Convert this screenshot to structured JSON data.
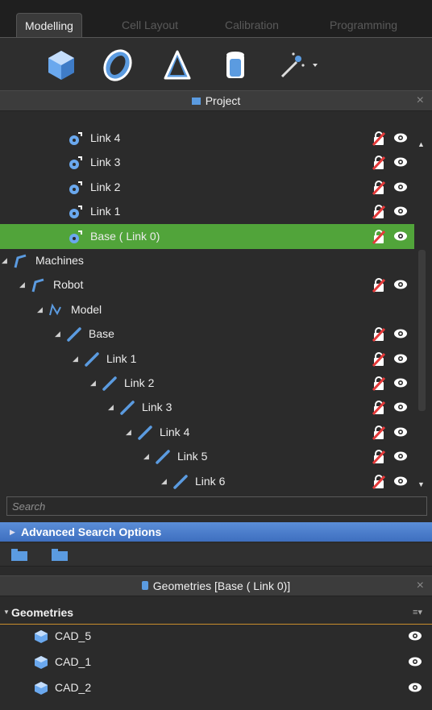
{
  "tabs": [
    {
      "label": "Modelling",
      "active": true
    },
    {
      "label": "Cell Layout",
      "active": false
    },
    {
      "label": "Calibration",
      "active": false
    },
    {
      "label": "Programming",
      "active": false
    }
  ],
  "toolbar": [
    {
      "icon": "box-icon"
    },
    {
      "icon": "ellipse-icon"
    },
    {
      "icon": "cone-icon"
    },
    {
      "icon": "cylinder-icon"
    },
    {
      "icon": "magic-wand-dropdown-icon"
    }
  ],
  "project": {
    "title": "Project",
    "close": "×",
    "menu": "≡▾"
  },
  "tree": [
    {
      "label": "Link 4",
      "indent": 4,
      "type": "link",
      "expand": false,
      "lock": true,
      "eye": true,
      "selected": false
    },
    {
      "label": "Link 3",
      "indent": 4,
      "type": "link",
      "expand": false,
      "lock": true,
      "eye": true,
      "selected": false
    },
    {
      "label": "Link 2",
      "indent": 4,
      "type": "link",
      "expand": false,
      "lock": true,
      "eye": true,
      "selected": false
    },
    {
      "label": "Link 1",
      "indent": 4,
      "type": "link",
      "expand": false,
      "lock": true,
      "eye": true,
      "selected": false
    },
    {
      "label": "Base ( Link 0)",
      "indent": 4,
      "type": "link",
      "expand": false,
      "lock": true,
      "eye": true,
      "selected": true
    },
    {
      "label": "Machines",
      "indent": 0,
      "type": "machine",
      "expand": true,
      "lock": false,
      "eye": false,
      "selected": false
    },
    {
      "label": "Robot",
      "indent": 1,
      "type": "machine",
      "expand": true,
      "lock": true,
      "eye": true,
      "selected": false
    },
    {
      "label": "Model",
      "indent": 2,
      "type": "model",
      "expand": true,
      "lock": false,
      "eye": false,
      "selected": false
    },
    {
      "label": "Base",
      "indent": 3,
      "type": "joint",
      "expand": true,
      "lock": true,
      "eye": true,
      "selected": false
    },
    {
      "label": "Link 1",
      "indent": 4,
      "type": "joint",
      "expand": true,
      "lock": true,
      "eye": true,
      "selected": false
    },
    {
      "label": "Link 2",
      "indent": 5,
      "type": "joint",
      "expand": true,
      "lock": true,
      "eye": true,
      "selected": false
    },
    {
      "label": "Link 3",
      "indent": 6,
      "type": "joint",
      "expand": true,
      "lock": true,
      "eye": true,
      "selected": false
    },
    {
      "label": "Link 4",
      "indent": 7,
      "type": "joint",
      "expand": true,
      "lock": true,
      "eye": true,
      "selected": false
    },
    {
      "label": "Link 5",
      "indent": 8,
      "type": "joint",
      "expand": true,
      "lock": true,
      "eye": true,
      "selected": false
    },
    {
      "label": "Link 6",
      "indent": 9,
      "type": "joint",
      "expand": true,
      "lock": true,
      "eye": true,
      "selected": false
    }
  ],
  "search": {
    "placeholder": "Search",
    "value": ""
  },
  "advanced": {
    "label": "Advanced Search Options"
  },
  "geometries_panel": {
    "title": "Geometries [Base ( Link 0)]",
    "close": "×",
    "subheader": "Geometries",
    "menu": "≡▾"
  },
  "geometries": [
    {
      "label": "CAD_5"
    },
    {
      "label": "CAD_1"
    },
    {
      "label": "CAD_2"
    }
  ],
  "colors": {
    "accent_blue": "#5b9be0",
    "selected_green": "#51a43a",
    "lock_red": "#e53a3a",
    "divider_orange": "#c88d2c"
  }
}
